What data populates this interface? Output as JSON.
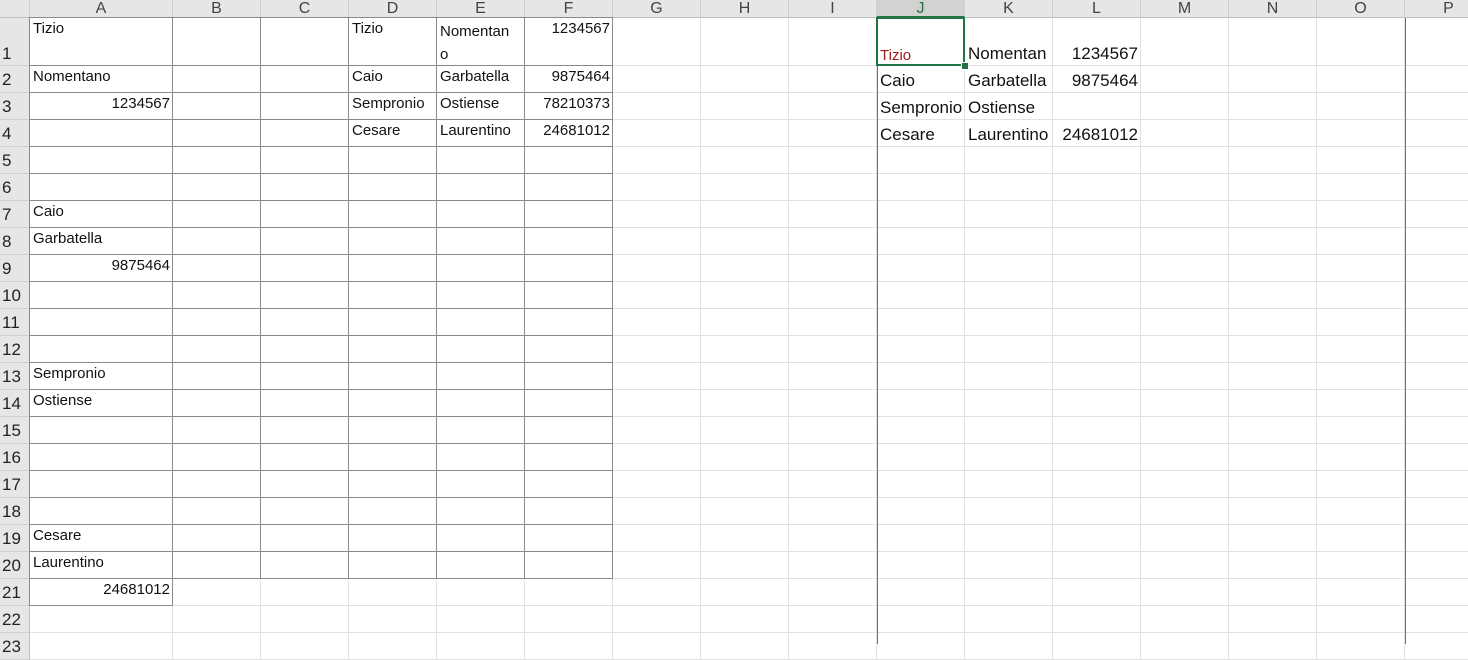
{
  "columns": [
    "A",
    "B",
    "C",
    "D",
    "E",
    "F",
    "G",
    "H",
    "I",
    "J",
    "K",
    "L",
    "M",
    "N",
    "O",
    "P"
  ],
  "rows": [
    "1",
    "2",
    "3",
    "4",
    "5",
    "6",
    "7",
    "8",
    "9",
    "10",
    "11",
    "12",
    "13",
    "14",
    "15",
    "16",
    "17",
    "18",
    "19",
    "20",
    "21",
    "22",
    "23"
  ],
  "active_column": "J",
  "cells": {
    "A1": "Tizio",
    "A2": "Nomentano",
    "A3": "1234567",
    "A7": "Caio",
    "A8": "Garbatella",
    "A9": "9875464",
    "A13": "Sempronio",
    "A14": "Ostiense",
    "A19": "Cesare",
    "A20": "Laurentino",
    "A21": "24681012",
    "D1": "Tizio",
    "E1a": "Nomentan",
    "E1b": "o",
    "F1": "1234567",
    "D2": "Caio",
    "E2": "Garbatella",
    "F2": "9875464",
    "D3": "Sempronio",
    "E3": "Ostiense",
    "F3": "78210373",
    "D4": "Cesare",
    "E4": "Laurentino",
    "F4": "24681012",
    "J1": "Tizio",
    "K1": "Nomentan",
    "L1": "1234567",
    "J2": "Caio",
    "K2": "Garbatella",
    "L2": "9875464",
    "J3": "Sempronio",
    "K3": "Ostiense",
    "J4": "Cesare",
    "K4": "Laurentino",
    "L4": "24681012"
  },
  "colors": {
    "accent": "#217346",
    "tizio_red": "#9c1c1c",
    "page_break": "#4a6fd1"
  }
}
